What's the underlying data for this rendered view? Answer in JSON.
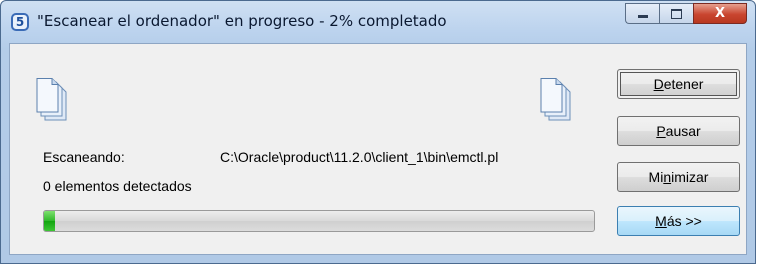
{
  "window": {
    "title": "\"Escanear el ordenador\" en progreso - 2% completado",
    "app_icon_glyph": "5",
    "caption": {
      "close_glyph": "X"
    }
  },
  "scan": {
    "scanning_label": "Escaneando:",
    "current_path": "C:\\Oracle\\product\\11.2.0\\client_1\\bin\\emctl.pl",
    "detected": "0 elementos detectados",
    "progress": 0.02
  },
  "buttons": {
    "stop": {
      "pre": "",
      "u": "D",
      "post": "etener"
    },
    "pause": {
      "pre": "",
      "u": "P",
      "post": "ausar"
    },
    "minimize": {
      "pre": "Mi",
      "u": "n",
      "post": "imizar"
    },
    "more": {
      "pre": "",
      "u": "M",
      "post": "ás >>"
    }
  },
  "colors": {
    "progress_fill": "#2fb82a",
    "title_bar": "#bcd3ee"
  },
  "icons": [
    "shield-5-app-icon",
    "minimize-icon",
    "maximize-icon",
    "close-icon",
    "document-stack-icon"
  ]
}
